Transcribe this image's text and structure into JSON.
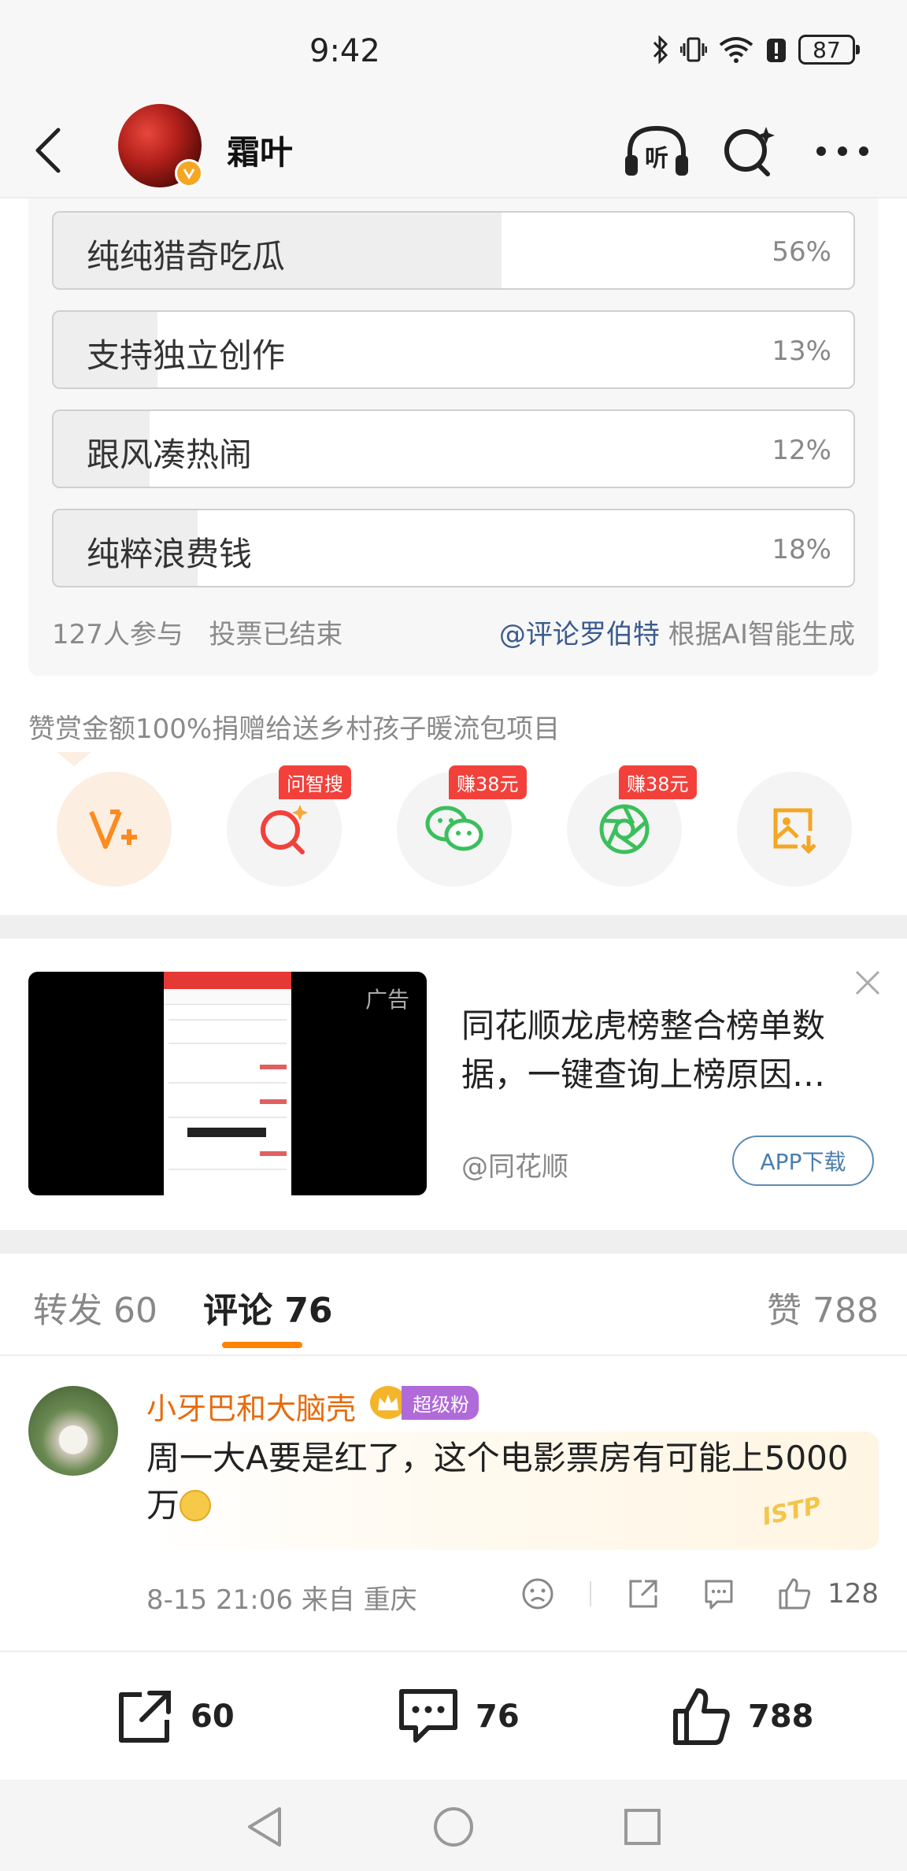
{
  "status_bar": {
    "time": "9:42",
    "battery": "87"
  },
  "header": {
    "title": "霜叶"
  },
  "poll": {
    "options": [
      {
        "label": "纯纯猎奇吃瓜",
        "percent": "56%",
        "value": 0.56
      },
      {
        "label": "支持独立创作",
        "percent": "13%",
        "value": 0.13
      },
      {
        "label": "跟风凑热闹",
        "percent": "12%",
        "value": 0.12
      },
      {
        "label": "纯粹浪费钱",
        "percent": "18%",
        "value": 0.18
      }
    ],
    "participants": "127人参与",
    "status": "投票已结束",
    "generated_by_mention": "@评论罗伯特",
    "generated_by_text": " 根据AI智能生成"
  },
  "donate_note": "赞赏金额100%捐赠给送乡村孩子暖流包项目",
  "share": {
    "tags": [
      "问智搜",
      "赚38元",
      "赚38元"
    ],
    "icons": [
      "v-plus-icon",
      "ai-search-icon",
      "wechat-icon",
      "moments-icon",
      "save-image-icon"
    ]
  },
  "ad": {
    "label": "广告",
    "title": "同花顺龙虎榜整合榜单数据，一键查询上榜原因…",
    "source": "@同花顺",
    "button": "APP下载"
  },
  "tabs": {
    "repost": "转发 60",
    "comments": "评论 76",
    "likes": "赞 788"
  },
  "comment": {
    "author": "小牙巴和大脑壳",
    "badge": "超级粉",
    "text": "周一大A要是红了，这个电影票房有可能上5000万",
    "deco": "ISTP",
    "meta": "8-15 21:06 来自 重庆",
    "likes": "128"
  },
  "bottom_bar": {
    "reposts": "60",
    "comments": "76",
    "likes": "788"
  },
  "colors": {
    "accent": "#ff8200",
    "name": "#e86b0c",
    "mention": "#3b5b8f",
    "tag": "#f2413b"
  }
}
